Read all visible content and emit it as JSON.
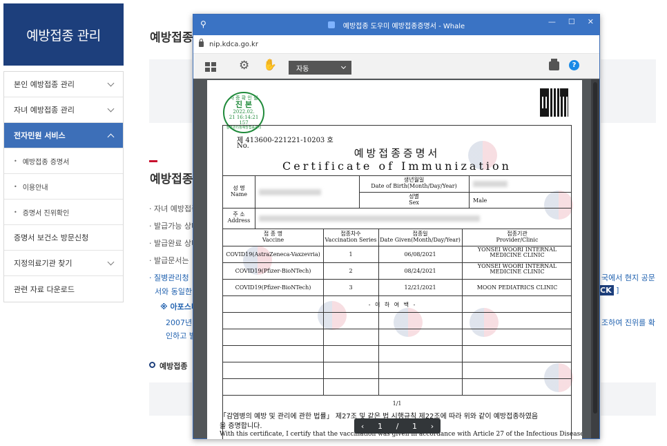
{
  "sidebar": {
    "header": "예방접종 관리",
    "items": [
      {
        "label": "본인 예방접종 관리"
      },
      {
        "label": "자녀 예방접종 관리"
      },
      {
        "label": "전자민원 서비스"
      },
      {
        "label": "증명서 보건소 방문신청"
      },
      {
        "label": "지정의료기관 찾기"
      },
      {
        "label": "관련 자료 다운로드"
      }
    ],
    "subitems": [
      {
        "label": "예방접종 증명서"
      },
      {
        "label": "이용안내"
      },
      {
        "label": "증명서 진위확인"
      }
    ]
  },
  "background": {
    "title1": "예방접종",
    "title2": "예방접종",
    "lines": [
      "자녀 예방접종",
      "발급가능 상태",
      "발급완료 상태",
      "발급문서는"
    ],
    "blue_line1": "질병관리청",
    "blue_line2": "서와 동일한",
    "note_prefix": "※ 아포스티",
    "note_line1": "2007년 7",
    "note_line2": "인하고 발",
    "right1": "국에서 현지 공문",
    "right_badge": "CK",
    "right_bracket": "]",
    "right2": "조하여 진위를 확",
    "section3": "예방접종"
  },
  "popup": {
    "title": "예방접종 도우미 예방접종증명서 - Whale",
    "url": "nip.kdca.go.kr",
    "zoom": "자동",
    "pager": {
      "current": "1",
      "separator": "/",
      "total": "1"
    }
  },
  "certificate": {
    "seal_lines": [
      "사 증 확 인 필",
      "진 본",
      "2022.02.",
      "21 16:14:21",
      "157",
      "질병관리청예방접종관리"
    ],
    "cert_no": "제  413600-221221-10203  호",
    "no_label": "No.",
    "title_ko": "예방접종증명서",
    "title_en": "Certificate of Immunization",
    "name_ko": "성    명",
    "name_en": "Name",
    "dob_ko": "생년월일",
    "dob_en": "Date of Birth(Month/Day/Year)",
    "sex_ko": "성별",
    "sex_en": "Sex",
    "sex_value": "Male",
    "addr_ko": "주    소",
    "addr_en": "Address",
    "col_vaccine_ko": "접 종 명",
    "col_vaccine_en": "Vaccine",
    "col_series_ko": "접종차수",
    "col_series_en": "Vaccination Series",
    "col_date_ko": "접종일",
    "col_date_en": "Date Given(Month/Day/Year)",
    "col_provider_ko": "접종기관",
    "col_provider_en": "Provider/Clinic",
    "rows": [
      {
        "vaccine": "COVID19(AstraZeneca-Vaxzevria)",
        "series": "1",
        "date": "06/08/2021",
        "provider": "YONSEI WOORI INTERNAL MEDICINE CLINIC"
      },
      {
        "vaccine": "COVID19(Pfizer-BioNTech)",
        "series": "2",
        "date": "08/24/2021",
        "provider": "YONSEI WOORI INTERNAL MEDICINE CLINIC"
      },
      {
        "vaccine": "COVID19(Pfizer-BioNTech)",
        "series": "3",
        "date": "12/21/2021",
        "provider": "MOON PEDIATRICS CLINIC"
      }
    ],
    "blank_marker": "- 이   하   여   백 -",
    "page_foot": "1/1",
    "legal1": "「감염병의 예방 및 관리에 관한 법률」 제27조 및 같은 법 시행규칙 제22조에 따라 위와 같이 예방접종하였음",
    "legal2": "을 증명합니다.",
    "legal3": "With this certificate, I certify that the vaccination was given in accordance with Article 27 of the Infectious Disease"
  }
}
